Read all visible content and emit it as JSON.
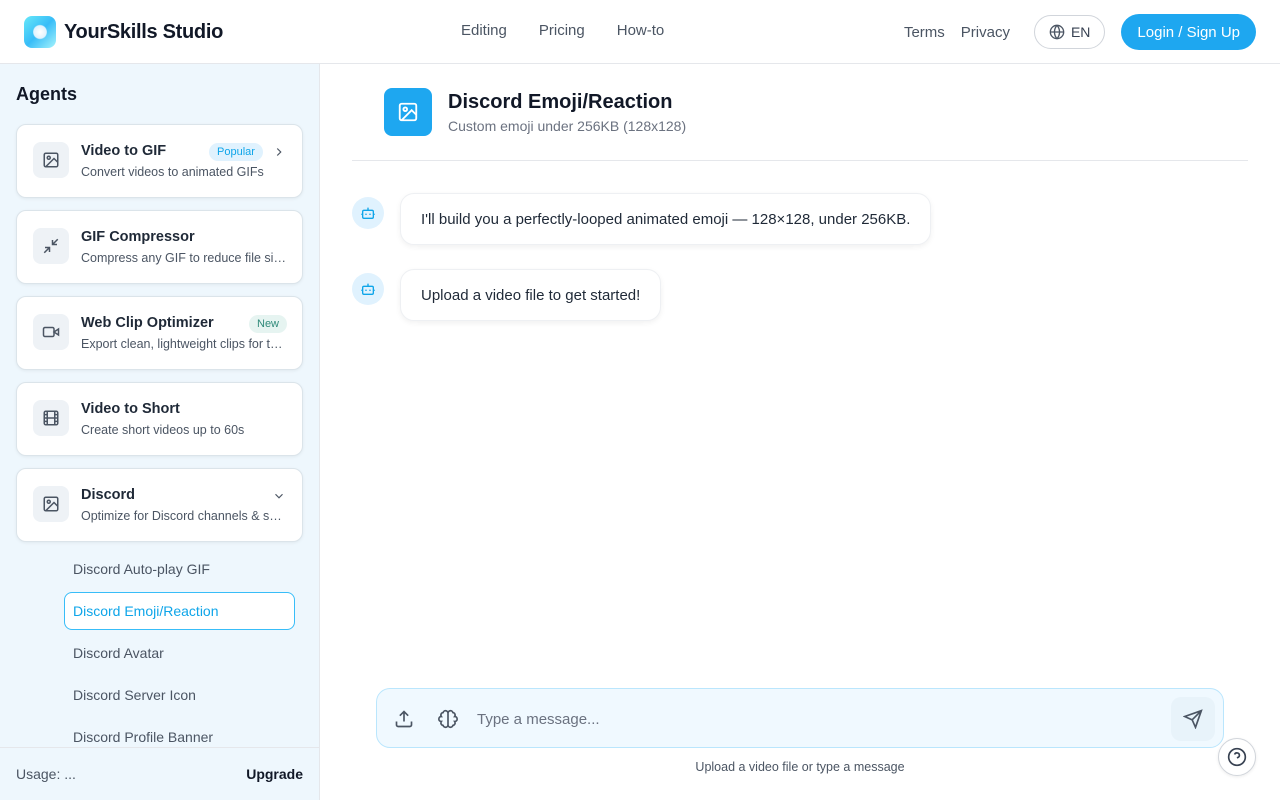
{
  "header": {
    "brand": "YourSkills Studio",
    "nav": [
      "Editing",
      "Pricing",
      "How-to"
    ],
    "links": [
      "Terms",
      "Privacy"
    ],
    "language": "EN",
    "login": "Login / Sign Up",
    "colors": {
      "accent": "#1ea7f0"
    }
  },
  "sidebar": {
    "title": "Agents",
    "agents": [
      {
        "name": "Video to GIF",
        "desc": "Convert videos to animated GIFs",
        "badge": "Popular",
        "icon": "image-icon"
      },
      {
        "name": "GIF Compressor",
        "desc": "Compress any GIF to reduce file size",
        "icon": "minimize-icon"
      },
      {
        "name": "Web Clip Optimizer",
        "desc": "Export clean, lightweight clips for the web",
        "badge": "New",
        "icon": "video-icon"
      },
      {
        "name": "Video to Short",
        "desc": "Create short videos up to 60s",
        "icon": "film-icon"
      },
      {
        "name": "Discord",
        "desc": "Optimize for Discord channels & servers",
        "icon": "image-icon"
      }
    ],
    "sub_items": [
      "Discord Auto-play GIF",
      "Discord Emoji/Reaction",
      "Discord Avatar",
      "Discord Server Icon",
      "Discord Profile Banner"
    ],
    "active_sub_item": "Discord Emoji/Reaction",
    "usage": "Usage: ...",
    "upgrade": "Upgrade"
  },
  "chat": {
    "title": "Discord Emoji/Reaction",
    "subtitle": "Custom emoji under 256KB (128x128)",
    "messages": [
      "I'll build you a perfectly-looped animated emoji — 128×128, under 256KB.",
      "Upload a video file to get started!"
    ],
    "input_placeholder": "Type a message...",
    "hint": "Upload a video file or type a message"
  }
}
